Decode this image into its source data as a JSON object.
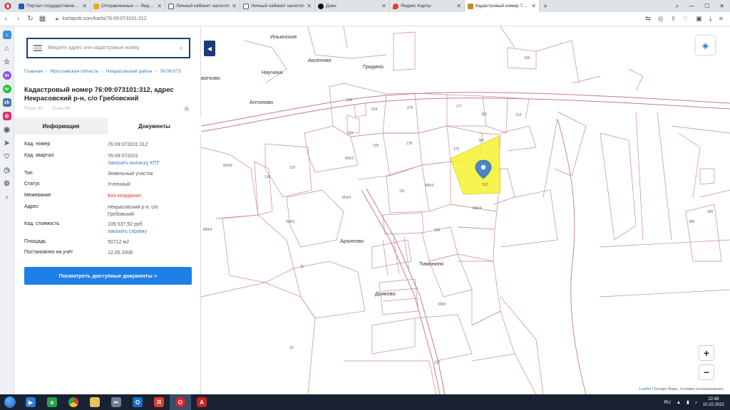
{
  "browser": {
    "tabs": [
      {
        "label": "Портал государственных",
        "color": "#1b5fb5"
      },
      {
        "label": "Отправленные — Яндекс",
        "color": "#f2a22c"
      },
      {
        "label": "Личный кабинет налогоп",
        "color": "#555555"
      },
      {
        "label": "Личный кабинет налогоп",
        "color": "#555555"
      },
      {
        "label": "Дзен",
        "color": "#111111"
      },
      {
        "label": "Яндекс Карты",
        "color": "#e63c2e"
      },
      {
        "label": "Кадастровый номер 76:09",
        "color": "#c48a2a",
        "active": true
      }
    ],
    "url": "kartapok.com/karta/76:09:073101:312"
  },
  "search": {
    "placeholder": "Введите адрес или кадастровый номер"
  },
  "breadcrumb": [
    "Главная",
    "Ярославская область",
    "Некрасовский район",
    "76:09:073"
  ],
  "title": "Кадастровый номер 76:09:073101:312, адрес Некрасовский р-н, с/о Гребовский",
  "plan_links": [
    "План ЗУ",
    "План КК"
  ],
  "tabs": {
    "info": "Информация",
    "docs": "Документы"
  },
  "properties": {
    "cad_number": {
      "label": "Кад. номер",
      "value": "76:09:073101:312"
    },
    "cad_quarter": {
      "label": "Кад. квартал",
      "value": "76:09:073101",
      "link": "Заказать выписку КПТ"
    },
    "type": {
      "label": "Тип",
      "value": "Земельный участок"
    },
    "status": {
      "label": "Статус",
      "value": "Учтенный"
    },
    "boundary": {
      "label": "Межевание",
      "value": "Без координат"
    },
    "address": {
      "label": "Адрес",
      "value": "Некрасовский р-н, с/о Гребовский"
    },
    "cad_cost": {
      "label": "Кад. стоимость",
      "value": "109 537,92 руб.",
      "link": "заказать справку"
    },
    "area": {
      "label": "Площадь",
      "value": "50712 м2"
    },
    "registered": {
      "label": "Постановлен на учёт",
      "value": "12.05.2008"
    }
  },
  "docs_button": "Посмотреть доступные документы >",
  "map": {
    "places": {
      "ilinskoe": "Ильинское",
      "aksenovo": "Аксеново",
      "nauchikha": "Научиха",
      "gridino": "Гридино",
      "antonovo": "Антоново",
      "arkhipovo": "Архипово",
      "timonino": "Тимонино",
      "dyakovo": "Дьяково",
      "vatkovo": "ватково"
    },
    "plots": {
      "p325": "325",
      "p636": "636",
      "p634": "634",
      "p279": "279",
      "p277": "277",
      "p281": "281",
      "p314": "314",
      "p315": "315",
      "p278": "278",
      "p280": "280",
      "p276": "276",
      "p8952a": "895/2",
      "p8958": "894/8",
      "p310": "310",
      "p316": "316",
      "p8953": "895/3",
      "p311": "311",
      "p312": "312",
      "p8954": "895/4",
      "p8942": "894/2",
      "p8944": "894/4",
      "p303": "303",
      "p11": "11",
      "p3669": "3669",
      "p10": "10",
      "p212": "212",
      "p390": "390",
      "p389": "389",
      "p633": "633",
      "p8952b": "894/2"
    },
    "highlight_color": "#f6f23c",
    "attribution": {
      "leaflet": "Leaflet",
      "rest": "| Google Maps, Условия использования,"
    }
  },
  "taskbar": {
    "lang": "RU",
    "time": "22:48",
    "date": "10.10.2022"
  }
}
